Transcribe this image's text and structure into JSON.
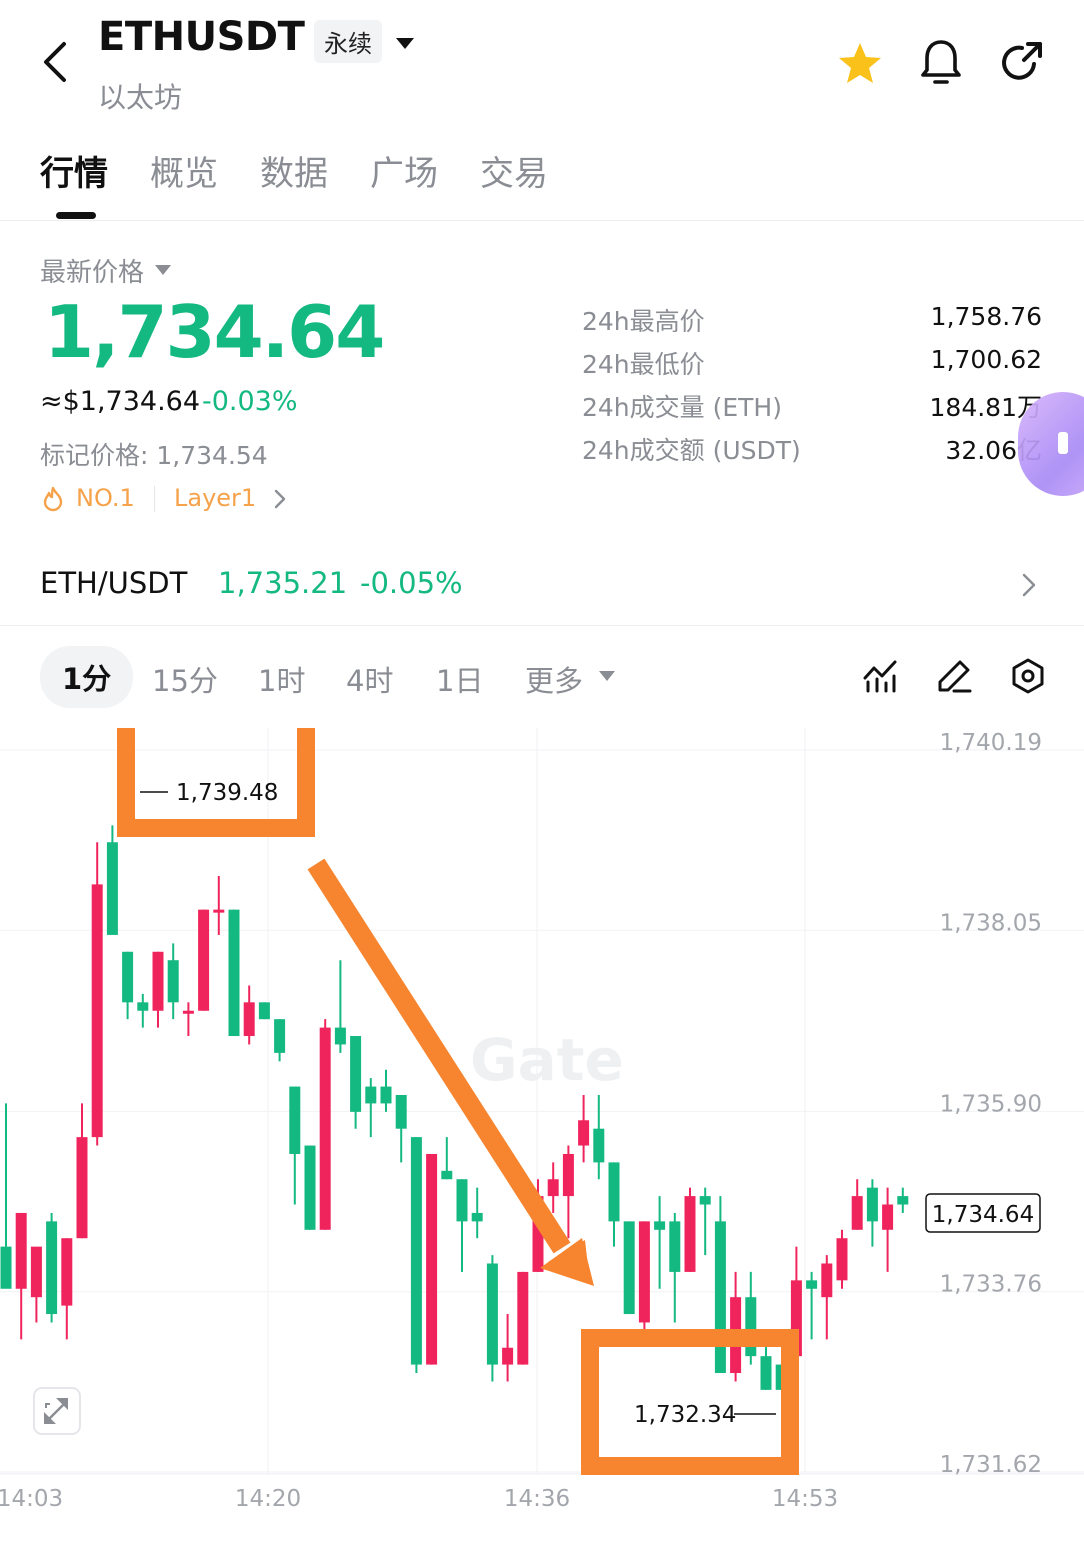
{
  "header": {
    "symbol": "ETHUSDT",
    "contract_type": "永续",
    "subtitle": "以太坊"
  },
  "tabs": [
    {
      "label": "行情",
      "active": true
    },
    {
      "label": "概览",
      "active": false
    },
    {
      "label": "数据",
      "active": false
    },
    {
      "label": "广场",
      "active": false
    },
    {
      "label": "交易",
      "active": false
    }
  ],
  "price": {
    "label": "最新价格",
    "last": "1,734.64",
    "usd": "≈$1,734.64",
    "change": "-0.03%",
    "mark": "标记价格: 1,734.54",
    "rank_tag": "NO.1",
    "sector_tag": "Layer1"
  },
  "stats": [
    {
      "label": "24h最高价",
      "value": "1,758.76"
    },
    {
      "label": "24h最低价",
      "value": "1,700.62"
    },
    {
      "label": "24h成交量 (ETH)",
      "value": "184.81万"
    },
    {
      "label": "24h成交额 (USDT)",
      "value": "32.06亿"
    }
  ],
  "spot": {
    "pair": "ETH/USDT",
    "price": "1,735.21",
    "change": "-0.05%"
  },
  "intervals": [
    {
      "label": "1分",
      "active": true
    },
    {
      "label": "15分",
      "active": false
    },
    {
      "label": "1时",
      "active": false
    },
    {
      "label": "4时",
      "active": false
    },
    {
      "label": "1日",
      "active": false
    },
    {
      "label": "更多",
      "active": false
    }
  ],
  "colors": {
    "up": "#f0245c",
    "down": "#14b881",
    "annotation": "#f7852f",
    "tag": "#f5a24a"
  },
  "chart_data": {
    "type": "candlestick",
    "watermark": "Gate",
    "y_ticks": [
      1740.19,
      1738.05,
      1735.9,
      1733.76,
      1731.62
    ],
    "y_tick_labels": [
      "1,740.19",
      "1,738.05",
      "1,735.90",
      "1,733.76",
      "1,731.62"
    ],
    "x_tick_labels": [
      "14:03",
      "14:20",
      "14:36",
      "14:53"
    ],
    "ylim": [
      1731.62,
      1740.19
    ],
    "high_marker": {
      "value": "1,739.48"
    },
    "low_marker": {
      "value": "1,732.34"
    },
    "last_price_tag": "1,734.64",
    "candles": [
      {
        "o": 1734.2,
        "h": 1735.9,
        "l": 1733.9,
        "c": 1733.7
      },
      {
        "o": 1733.7,
        "h": 1733.9,
        "l": 1733.1,
        "c": 1734.6
      },
      {
        "o": 1733.6,
        "h": 1734.0,
        "l": 1733.3,
        "c": 1734.2
      },
      {
        "o": 1734.5,
        "h": 1734.6,
        "l": 1733.3,
        "c": 1733.4
      },
      {
        "o": 1733.5,
        "h": 1734.3,
        "l": 1733.1,
        "c": 1734.3
      },
      {
        "o": 1734.3,
        "h": 1735.9,
        "l": 1734.3,
        "c": 1735.5
      },
      {
        "o": 1735.5,
        "h": 1739.0,
        "l": 1735.4,
        "c": 1738.5
      },
      {
        "o": 1739.0,
        "h": 1739.2,
        "l": 1738.0,
        "c": 1737.9
      },
      {
        "o": 1737.7,
        "h": 1737.7,
        "l": 1736.9,
        "c": 1737.1
      },
      {
        "o": 1737.1,
        "h": 1737.2,
        "l": 1736.8,
        "c": 1737.0
      },
      {
        "o": 1737.0,
        "h": 1737.7,
        "l": 1736.8,
        "c": 1737.7
      },
      {
        "o": 1737.6,
        "h": 1737.8,
        "l": 1736.9,
        "c": 1737.1
      },
      {
        "o": 1737.0,
        "h": 1737.1,
        "l": 1736.7,
        "c": 1737.0
      },
      {
        "o": 1737.0,
        "h": 1738.2,
        "l": 1737.0,
        "c": 1738.2
      },
      {
        "o": 1738.2,
        "h": 1738.6,
        "l": 1737.9,
        "c": 1738.2
      },
      {
        "o": 1738.2,
        "h": 1738.2,
        "l": 1736.7,
        "c": 1736.7
      },
      {
        "o": 1736.7,
        "h": 1737.3,
        "l": 1736.6,
        "c": 1737.1
      },
      {
        "o": 1737.1,
        "h": 1737.1,
        "l": 1736.9,
        "c": 1736.9
      },
      {
        "o": 1736.9,
        "h": 1736.9,
        "l": 1736.4,
        "c": 1736.5
      },
      {
        "o": 1736.1,
        "h": 1736.1,
        "l": 1734.7,
        "c": 1735.3
      },
      {
        "o": 1735.4,
        "h": 1735.4,
        "l": 1734.4,
        "c": 1734.4
      },
      {
        "o": 1734.4,
        "h": 1736.9,
        "l": 1734.4,
        "c": 1736.8
      },
      {
        "o": 1736.8,
        "h": 1737.6,
        "l": 1736.5,
        "c": 1736.6
      },
      {
        "o": 1736.7,
        "h": 1736.7,
        "l": 1735.6,
        "c": 1735.8
      },
      {
        "o": 1736.1,
        "h": 1736.2,
        "l": 1735.5,
        "c": 1735.9
      },
      {
        "o": 1736.1,
        "h": 1736.3,
        "l": 1735.8,
        "c": 1735.9
      },
      {
        "o": 1736.0,
        "h": 1736.0,
        "l": 1735.2,
        "c": 1735.6
      },
      {
        "o": 1735.5,
        "h": 1735.5,
        "l": 1732.7,
        "c": 1732.8
      },
      {
        "o": 1732.8,
        "h": 1735.3,
        "l": 1732.8,
        "c": 1735.3
      },
      {
        "o": 1735.1,
        "h": 1735.5,
        "l": 1735.0,
        "c": 1735.0
      },
      {
        "o": 1735.0,
        "h": 1735.0,
        "l": 1733.9,
        "c": 1734.5
      },
      {
        "o": 1734.6,
        "h": 1734.9,
        "l": 1734.3,
        "c": 1734.5
      },
      {
        "o": 1734.0,
        "h": 1734.1,
        "l": 1732.6,
        "c": 1732.8
      },
      {
        "o": 1732.8,
        "h": 1733.4,
        "l": 1732.6,
        "c": 1733.0
      },
      {
        "o": 1732.8,
        "h": 1733.9,
        "l": 1732.8,
        "c": 1733.9
      },
      {
        "o": 1733.9,
        "h": 1735.0,
        "l": 1733.9,
        "c": 1734.8
      },
      {
        "o": 1734.8,
        "h": 1735.2,
        "l": 1734.6,
        "c": 1735.0
      },
      {
        "o": 1734.8,
        "h": 1735.4,
        "l": 1734.3,
        "c": 1735.3
      },
      {
        "o": 1735.4,
        "h": 1736.0,
        "l": 1735.2,
        "c": 1735.7
      },
      {
        "o": 1735.6,
        "h": 1736.0,
        "l": 1735.0,
        "c": 1735.2
      },
      {
        "o": 1735.2,
        "h": 1735.2,
        "l": 1734.2,
        "c": 1734.5
      },
      {
        "o": 1734.5,
        "h": 1734.5,
        "l": 1733.4,
        "c": 1733.4
      },
      {
        "o": 1733.3,
        "h": 1734.5,
        "l": 1733.1,
        "c": 1734.5
      },
      {
        "o": 1734.5,
        "h": 1734.8,
        "l": 1733.7,
        "c": 1734.4
      },
      {
        "o": 1734.5,
        "h": 1734.6,
        "l": 1733.3,
        "c": 1733.9
      },
      {
        "o": 1733.9,
        "h": 1734.9,
        "l": 1733.9,
        "c": 1734.8
      },
      {
        "o": 1734.8,
        "h": 1734.9,
        "l": 1734.1,
        "c": 1734.7
      },
      {
        "o": 1734.5,
        "h": 1734.8,
        "l": 1732.9,
        "c": 1732.7
      },
      {
        "o": 1732.7,
        "h": 1733.9,
        "l": 1732.6,
        "c": 1733.6
      },
      {
        "o": 1733.6,
        "h": 1733.9,
        "l": 1732.8,
        "c": 1732.9
      },
      {
        "o": 1732.9,
        "h": 1733.1,
        "l": 1732.5,
        "c": 1732.5
      },
      {
        "o": 1732.8,
        "h": 1732.8,
        "l": 1732.5,
        "c": 1732.5
      },
      {
        "o": 1732.9,
        "h": 1734.2,
        "l": 1732.9,
        "c": 1733.8
      },
      {
        "o": 1733.8,
        "h": 1733.9,
        "l": 1733.1,
        "c": 1733.7
      },
      {
        "o": 1733.6,
        "h": 1734.1,
        "l": 1733.1,
        "c": 1734.0
      },
      {
        "o": 1733.8,
        "h": 1734.4,
        "l": 1733.7,
        "c": 1734.3
      },
      {
        "o": 1734.4,
        "h": 1735.0,
        "l": 1734.4,
        "c": 1734.8
      },
      {
        "o": 1734.9,
        "h": 1735.0,
        "l": 1734.2,
        "c": 1734.5
      },
      {
        "o": 1734.4,
        "h": 1734.9,
        "l": 1733.9,
        "c": 1734.7
      },
      {
        "o": 1734.8,
        "h": 1734.9,
        "l": 1734.6,
        "c": 1734.7
      }
    ]
  }
}
